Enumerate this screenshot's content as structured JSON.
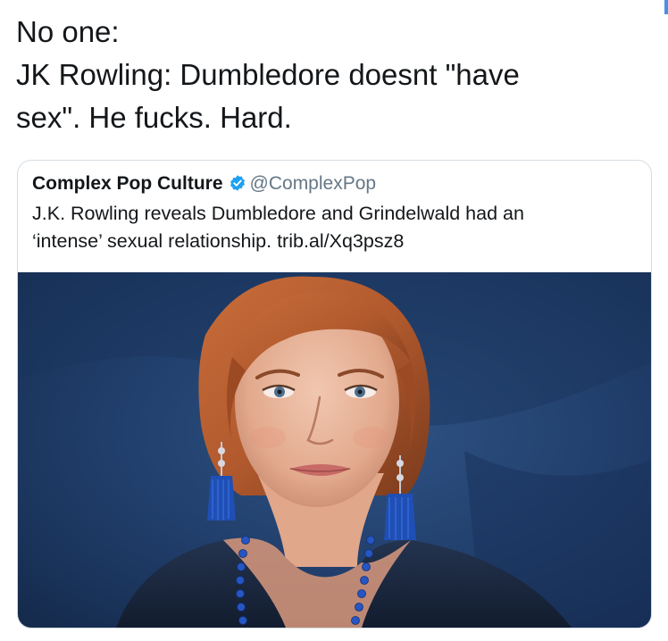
{
  "tweet": {
    "lines": [
      "No one:",
      "JK Rowling: Dumbledore doesnt \"have",
      "sex\". He fucks. Hard."
    ]
  },
  "quoted_tweet": {
    "author_name": "Complex Pop Culture",
    "handle": "@ComplexPop",
    "verified_icon": "verified-badge-icon",
    "lines": [
      "J.K. Rowling reveals Dumbledore and Grindelwald had an",
      "‘intense’ sexual relationship. trib.al/Xq3psz8"
    ],
    "photo": "portrait photo of a red-haired woman with blue tassel earrings and a blue beaded necklace"
  },
  "colors": {
    "text": "#14171a",
    "handle": "#657786",
    "verified": "#1da1f2",
    "photo_background": "#1d3a63",
    "hair": "#b25a2e"
  }
}
